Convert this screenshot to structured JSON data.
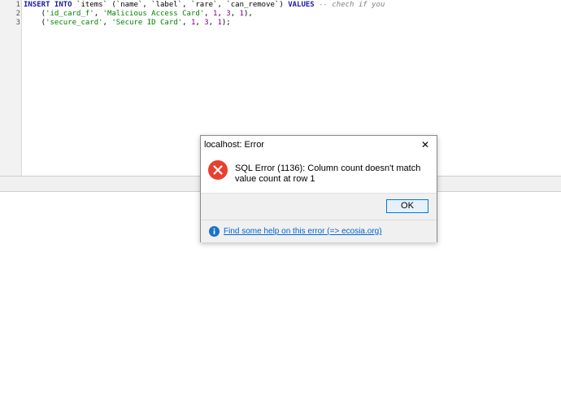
{
  "editor": {
    "line_numbers": [
      "1",
      "2",
      "3"
    ],
    "lines": [
      [
        {
          "t": "INSERT INTO ",
          "c": "kw"
        },
        {
          "t": "`items`",
          "c": "id"
        },
        {
          "t": " (",
          "c": "punc"
        },
        {
          "t": "`name`",
          "c": "id"
        },
        {
          "t": ", ",
          "c": "punc"
        },
        {
          "t": "`label`",
          "c": "id"
        },
        {
          "t": ", ",
          "c": "punc"
        },
        {
          "t": "`rare`",
          "c": "id"
        },
        {
          "t": ", ",
          "c": "punc"
        },
        {
          "t": "`can_remove`",
          "c": "id"
        },
        {
          "t": ") ",
          "c": "punc"
        },
        {
          "t": "VALUES",
          "c": "kw"
        },
        {
          "t": " -- chech if you",
          "c": "cmt"
        }
      ],
      [
        {
          "t": "    (",
          "c": "punc"
        },
        {
          "t": "'id_card_f'",
          "c": "str"
        },
        {
          "t": ", ",
          "c": "punc"
        },
        {
          "t": "'Malicious Access Card'",
          "c": "str"
        },
        {
          "t": ", ",
          "c": "punc"
        },
        {
          "t": "1",
          "c": "num"
        },
        {
          "t": ", ",
          "c": "punc"
        },
        {
          "t": "3",
          "c": "num"
        },
        {
          "t": ", ",
          "c": "punc"
        },
        {
          "t": "1",
          "c": "num"
        },
        {
          "t": "),",
          "c": "punc"
        }
      ],
      [
        {
          "t": "    (",
          "c": "punc"
        },
        {
          "t": "'secure_card'",
          "c": "str"
        },
        {
          "t": ", ",
          "c": "punc"
        },
        {
          "t": "'Secure ID Card'",
          "c": "str"
        },
        {
          "t": ", ",
          "c": "punc"
        },
        {
          "t": "1",
          "c": "num"
        },
        {
          "t": ", ",
          "c": "punc"
        },
        {
          "t": "3",
          "c": "num"
        },
        {
          "t": ", ",
          "c": "punc"
        },
        {
          "t": "1",
          "c": "num"
        },
        {
          "t": ");",
          "c": "punc"
        }
      ]
    ]
  },
  "dialog": {
    "title": "localhost: Error",
    "close_glyph": "✕",
    "message": "SQL Error (1136): Column count doesn't match value count at row 1",
    "ok_label": "OK",
    "help_link": "Find some help on this error (=> ecosia.org)",
    "error_icon": "error-circle-x-icon",
    "info_icon": "info-circle-icon"
  },
  "colors": {
    "error_red": "#e8402e",
    "info_blue": "#1b73c8",
    "link_blue": "#0066cc",
    "keyword": "#1a1aa6",
    "string": "#008000",
    "number": "#800080",
    "comment": "#808080"
  }
}
